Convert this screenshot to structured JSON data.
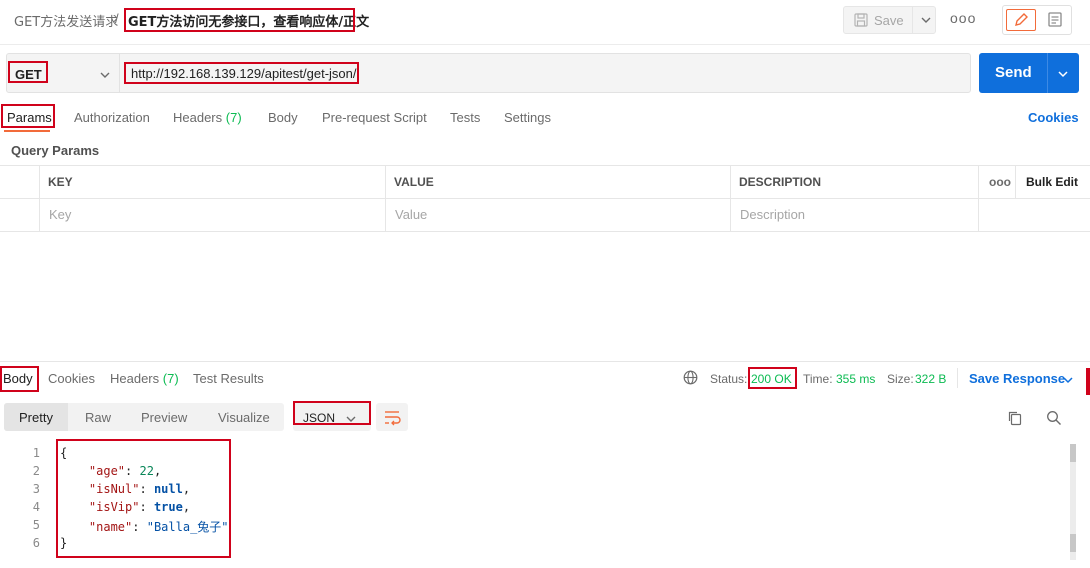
{
  "header": {
    "breadcrumb_parent": "GET方法发送请求",
    "breadcrumb_separator": "/",
    "request_title": "GET方法访问无参接口，查看响应体/正文",
    "save_label": "Save",
    "more_label": "ooo"
  },
  "request": {
    "method": "GET",
    "url": "http://192.168.139.129/apitest/get-json/",
    "send_label": "Send"
  },
  "request_tabs": [
    {
      "label": "Params",
      "count": ""
    },
    {
      "label": "Authorization",
      "count": ""
    },
    {
      "label": "Headers",
      "count": "(7)"
    },
    {
      "label": "Body",
      "count": ""
    },
    {
      "label": "Pre-request Script",
      "count": ""
    },
    {
      "label": "Tests",
      "count": ""
    },
    {
      "label": "Settings",
      "count": ""
    }
  ],
  "cookies_label": "Cookies",
  "query_params": {
    "title": "Query Params",
    "columns": [
      "KEY",
      "VALUE",
      "DESCRIPTION"
    ],
    "more_label": "ooo",
    "bulk_edit_label": "Bulk Edit",
    "placeholders": [
      "Key",
      "Value",
      "Description"
    ]
  },
  "response": {
    "tabs": [
      {
        "label": "Body",
        "count": ""
      },
      {
        "label": "Cookies",
        "count": ""
      },
      {
        "label": "Headers",
        "count": "(7)"
      },
      {
        "label": "Test Results",
        "count": ""
      }
    ],
    "status_label": "Status:",
    "status_value": "200 OK",
    "time_label": "Time:",
    "time_value": "355 ms",
    "size_label": "Size:",
    "size_value": "322 B",
    "save_response_label": "Save Response",
    "view_modes": [
      "Pretty",
      "Raw",
      "Preview",
      "Visualize"
    ],
    "format": "JSON",
    "line_numbers": [
      "1",
      "2",
      "3",
      "4",
      "5",
      "6"
    ],
    "body": {
      "open": "{",
      "close": "}",
      "age_key": "\"age\"",
      "age_val": "22",
      "isNul_key": "\"isNul\"",
      "isNul_val": "null",
      "isVip_key": "\"isVip\"",
      "isVip_val": "true",
      "name_key": "\"name\"",
      "name_val": "\"Balla_兔子\""
    }
  },
  "colors": {
    "accent": "#f26b3a",
    "primary": "#0f6fdc",
    "success": "#0cbb52",
    "annotation": "#d0021b"
  },
  "icons": [
    "save-icon",
    "chevron-down-icon",
    "more-icon",
    "edit-icon",
    "documentation-icon",
    "globe-icon",
    "word-wrap-icon",
    "copy-icon",
    "search-icon"
  ]
}
